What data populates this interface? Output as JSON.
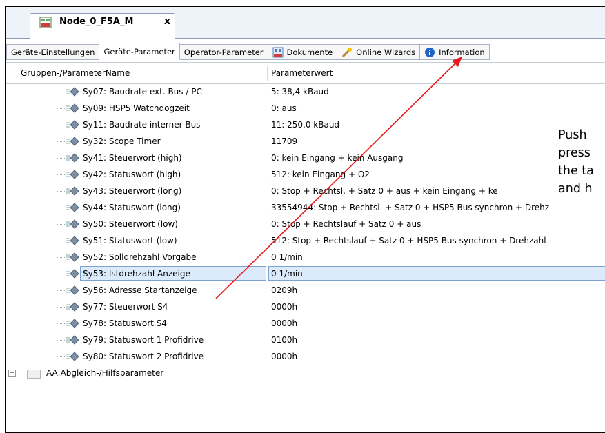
{
  "document_tab": {
    "title": "Node_0_F5A_M",
    "close": "x"
  },
  "subtabs": [
    {
      "label": "Geräte-Einstellungen",
      "icon": ""
    },
    {
      "label": "Geräte-Parameter",
      "icon": "",
      "active": true
    },
    {
      "label": "Operator-Parameter",
      "icon": ""
    },
    {
      "label": "Dokumente",
      "icon": "document-icon"
    },
    {
      "label": "Online Wizards",
      "icon": "wizard-icon"
    },
    {
      "label": "Information",
      "icon": "info-icon"
    }
  ],
  "grid": {
    "header": {
      "name": "Gruppen-/ParameterName",
      "value": "Parameterwert"
    },
    "rows": [
      {
        "name": "Sy07: Baudrate ext. Bus / PC",
        "value": "5: 38,4 kBaud"
      },
      {
        "name": "Sy09: HSP5 Watchdogzeit",
        "value": "0: aus"
      },
      {
        "name": "Sy11: Baudrate interner Bus",
        "value": "11: 250,0 kBaud"
      },
      {
        "name": "Sy32: Scope Timer",
        "value": "11709"
      },
      {
        "name": "Sy41: Steuerwort (high)",
        "value": "0: kein Eingang + kein Ausgang"
      },
      {
        "name": "Sy42: Statuswort (high)",
        "value": "512: kein Eingang + O2"
      },
      {
        "name": "Sy43: Steuerwort (long)",
        "value": "0: Stop + Rechtsl. + Satz 0 + aus + kein Eingang + ke"
      },
      {
        "name": "Sy44: Statuswort (long)",
        "value": "33554944: Stop + Rechtsl. + Satz 0 + HSP5 Bus synchron + Drehz"
      },
      {
        "name": "Sy50: Steuerwort (low)",
        "value": "0: Stop + Rechtslauf + Satz 0 + aus"
      },
      {
        "name": "Sy51: Statuswort (low)",
        "value": "512: Stop + Rechtslauf + Satz 0 + HSP5 Bus synchron + Drehzahl"
      },
      {
        "name": "Sy52: Solldrehzahl Vorgabe",
        "value": "0 1/min"
      },
      {
        "name": "Sy53: Istdrehzahl Anzeige",
        "value": "0 1/min",
        "selected": true
      },
      {
        "name": "Sy56: Adresse Startanzeige",
        "value": "0209h"
      },
      {
        "name": "Sy77: Steuerwort S4",
        "value": "0000h"
      },
      {
        "name": "Sy78: Statuswort S4",
        "value": "0000h"
      },
      {
        "name": "Sy79: Statuswort 1 Profidrive",
        "value": "0100h"
      },
      {
        "name": "Sy80: Statuswort 2 Profidrive",
        "value": "0000h"
      }
    ],
    "groups": [
      {
        "name": "AA:Abgleich-/Hilfsparameter",
        "expander": "+"
      }
    ]
  },
  "annotation": {
    "lines": [
      "Push",
      "press",
      "the ta",
      "and h"
    ],
    "arrow_color": "#e8191a"
  }
}
